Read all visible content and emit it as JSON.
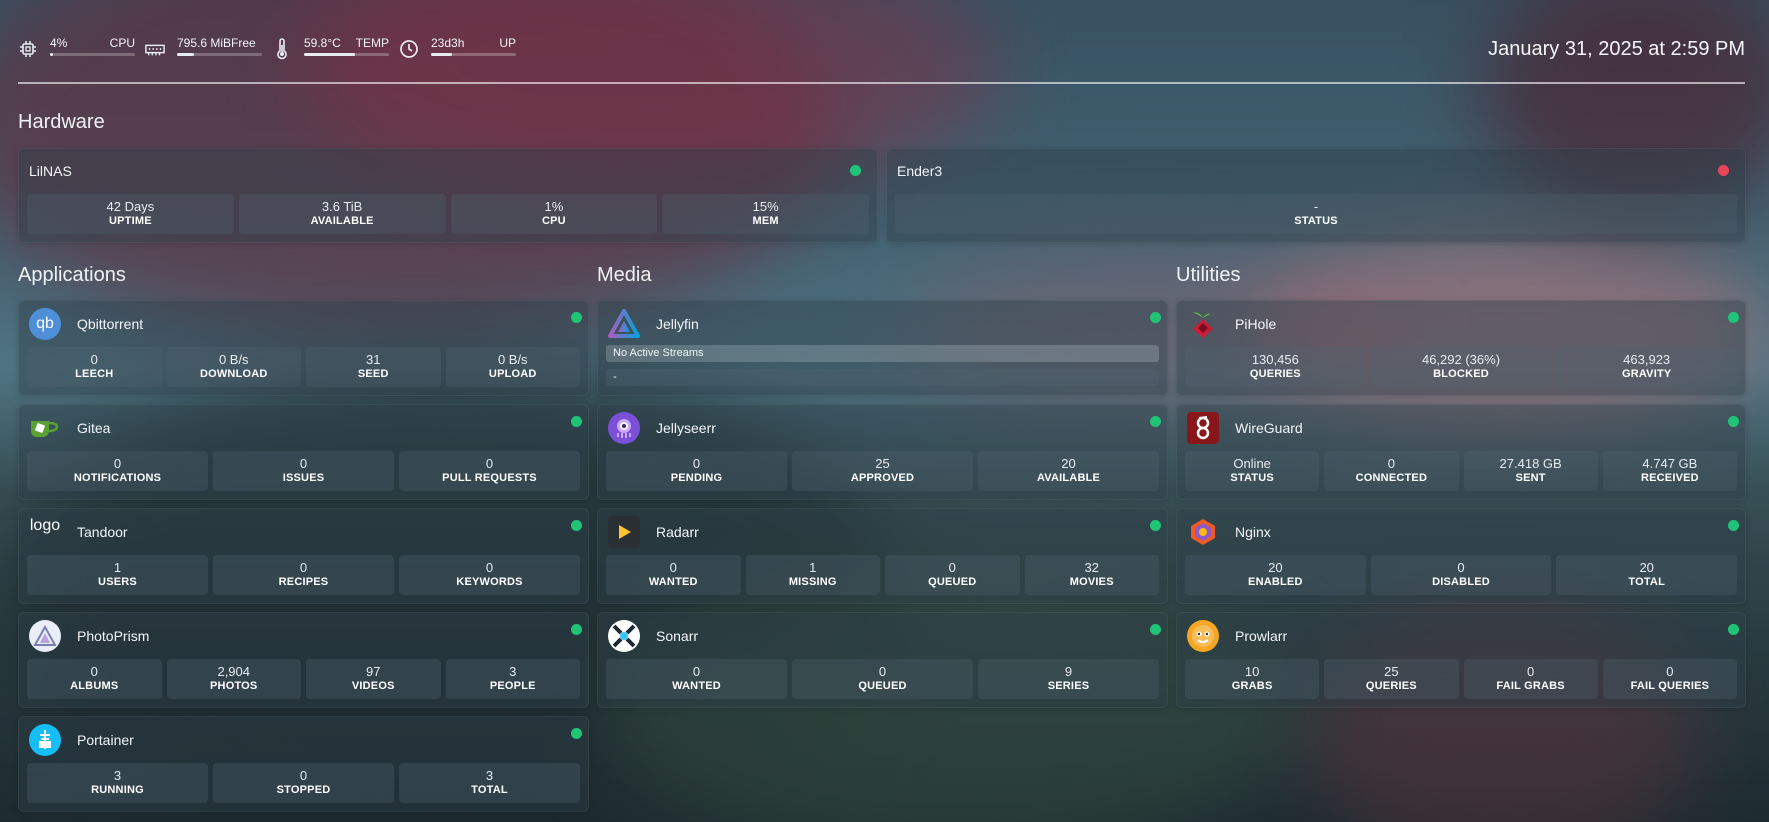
{
  "topbar": {
    "cpu": {
      "value": "4%",
      "label": "CPU",
      "fill": 0.04
    },
    "memory": {
      "value": "795.6 MiBFree",
      "fill": 0.2
    },
    "temp": {
      "value": "59.8°C",
      "label": "TEMP",
      "fill": 0.6
    },
    "uptime": {
      "value": "23d3h",
      "label": "UP",
      "fill": 0.25
    },
    "datetime": "January 31, 2025 at 2:59 PM"
  },
  "sections": {
    "hardware": "Hardware",
    "applications": "Applications",
    "media": "Media",
    "utilities": "Utilities"
  },
  "hardware": [
    {
      "name": "LilNAS",
      "status": "online",
      "stats": [
        {
          "v": "42 Days",
          "l": "UPTIME"
        },
        {
          "v": "3.6 TiB",
          "l": "AVAILABLE"
        },
        {
          "v": "1%",
          "l": "CPU"
        },
        {
          "v": "15%",
          "l": "MEM"
        }
      ]
    },
    {
      "name": "Ender3",
      "status": "offline",
      "stats": [
        {
          "v": "-",
          "l": "STATUS"
        }
      ]
    }
  ],
  "applications": [
    {
      "name": "Qbittorrent",
      "icon": "qbittorrent-icon",
      "icon_text": "qb",
      "stats": [
        {
          "v": "0",
          "l": "LEECH"
        },
        {
          "v": "0 B/s",
          "l": "DOWNLOAD"
        },
        {
          "v": "31",
          "l": "SEED"
        },
        {
          "v": "0 B/s",
          "l": "UPLOAD"
        }
      ]
    },
    {
      "name": "Gitea",
      "icon": "gitea-icon",
      "stats": [
        {
          "v": "0",
          "l": "NOTIFICATIONS"
        },
        {
          "v": "0",
          "l": "ISSUES"
        },
        {
          "v": "0",
          "l": "PULL REQUESTS"
        }
      ]
    },
    {
      "name": "Tandoor",
      "icon": "tandoor-logo-icon",
      "icon_text": "logo",
      "stats": [
        {
          "v": "1",
          "l": "USERS"
        },
        {
          "v": "0",
          "l": "RECIPES"
        },
        {
          "v": "0",
          "l": "KEYWORDS"
        }
      ]
    },
    {
      "name": "PhotoPrism",
      "icon": "photoprism-icon",
      "stats": [
        {
          "v": "0",
          "l": "ALBUMS"
        },
        {
          "v": "2,904",
          "l": "PHOTOS"
        },
        {
          "v": "97",
          "l": "VIDEOS"
        },
        {
          "v": "3",
          "l": "PEOPLE"
        }
      ]
    },
    {
      "name": "Portainer",
      "icon": "portainer-icon",
      "stats": [
        {
          "v": "3",
          "l": "RUNNING"
        },
        {
          "v": "0",
          "l": "STOPPED"
        },
        {
          "v": "3",
          "l": "TOTAL"
        }
      ]
    }
  ],
  "media": [
    {
      "name": "Jellyfin",
      "icon": "jellyfin-icon",
      "streams_label": "No Active Streams",
      "streams_value": "-"
    },
    {
      "name": "Jellyseerr",
      "icon": "jellyseerr-icon",
      "stats": [
        {
          "v": "0",
          "l": "PENDING"
        },
        {
          "v": "25",
          "l": "APPROVED"
        },
        {
          "v": "20",
          "l": "AVAILABLE"
        }
      ]
    },
    {
      "name": "Radarr",
      "icon": "radarr-icon",
      "stats": [
        {
          "v": "0",
          "l": "WANTED"
        },
        {
          "v": "1",
          "l": "MISSING"
        },
        {
          "v": "0",
          "l": "QUEUED"
        },
        {
          "v": "32",
          "l": "MOVIES"
        }
      ]
    },
    {
      "name": "Sonarr",
      "icon": "sonarr-icon",
      "stats": [
        {
          "v": "0",
          "l": "WANTED"
        },
        {
          "v": "0",
          "l": "QUEUED"
        },
        {
          "v": "9",
          "l": "SERIES"
        }
      ]
    }
  ],
  "utilities": [
    {
      "name": "PiHole",
      "icon": "pihole-icon",
      "stats": [
        {
          "v": "130,456",
          "l": "QUERIES"
        },
        {
          "v": "46,292 (36%)",
          "l": "BLOCKED"
        },
        {
          "v": "463,923",
          "l": "GRAVITY"
        }
      ]
    },
    {
      "name": "WireGuard",
      "icon": "wireguard-icon",
      "stats": [
        {
          "v": "Online",
          "l": "STATUS"
        },
        {
          "v": "0",
          "l": "CONNECTED"
        },
        {
          "v": "27.418 GB",
          "l": "SENT"
        },
        {
          "v": "4.747 GB",
          "l": "RECEIVED"
        }
      ]
    },
    {
      "name": "Nginx",
      "icon": "nginx-proxy-manager-icon",
      "stats": [
        {
          "v": "20",
          "l": "ENABLED"
        },
        {
          "v": "0",
          "l": "DISABLED"
        },
        {
          "v": "20",
          "l": "TOTAL"
        }
      ]
    },
    {
      "name": "Prowlarr",
      "icon": "prowlarr-icon",
      "stats": [
        {
          "v": "10",
          "l": "GRABS"
        },
        {
          "v": "25",
          "l": "QUERIES"
        },
        {
          "v": "0",
          "l": "FAIL GRABS"
        },
        {
          "v": "0",
          "l": "FAIL QUERIES"
        }
      ]
    }
  ],
  "colors": {
    "online": "#20c477",
    "offline": "#e8445a"
  }
}
